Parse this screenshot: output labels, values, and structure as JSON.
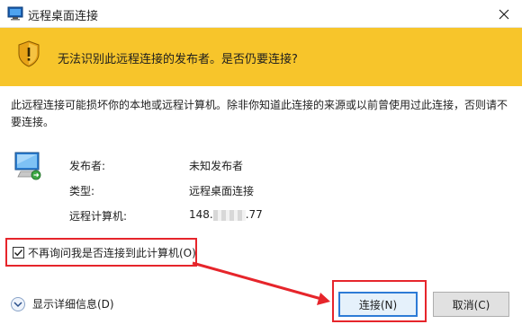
{
  "window": {
    "title": "远程桌面连接"
  },
  "banner": {
    "message": "无法识别此远程连接的发布者。是否仍要连接?"
  },
  "description": "此远程连接可能损坏你的本地或远程计算机。除非你知道此连接的来源或以前曾使用过此连接，否则请不要连接。",
  "info": {
    "publisher_label": "发布者:",
    "publisher_value": "未知发布者",
    "type_label": "类型:",
    "type_value": "远程桌面连接",
    "computer_label": "远程计算机:",
    "computer_value_prefix": "148.",
    "computer_value_suffix": ".77"
  },
  "checkbox": {
    "label": "不再询问我是否连接到此计算机(O)",
    "checked": true
  },
  "details": {
    "label": "显示详细信息(D)"
  },
  "buttons": {
    "connect": "连接(N)",
    "cancel": "取消(C)"
  },
  "colors": {
    "banner": "#f7c52b",
    "highlight": "#e6252b",
    "focus": "#2d7bd6"
  },
  "icons": [
    "remote-desktop-icon",
    "close-icon",
    "shield-warning-icon",
    "computer-icon",
    "checkmark-icon",
    "chevron-down-icon"
  ]
}
